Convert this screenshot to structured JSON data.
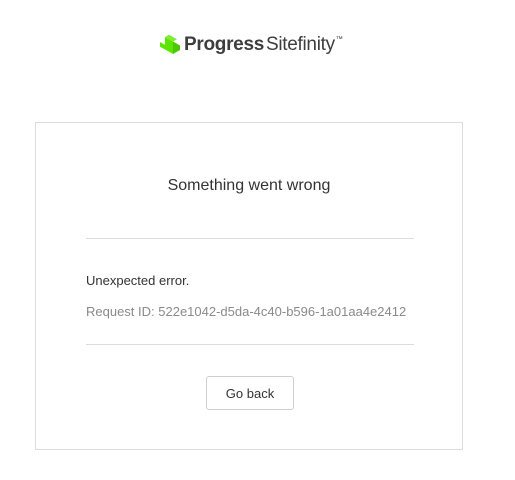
{
  "header": {
    "logo_brand": "Progress",
    "logo_product": "Sitefinity",
    "logo_trademark": "™",
    "logo_icon": "progress-logo-icon",
    "brand_color": "#5ce500"
  },
  "card": {
    "title": "Something went wrong",
    "error_message": "Unexpected error.",
    "request_id": "Request ID: 522e1042-d5da-4c40-b596-1a01aa4e2412",
    "back_button_label": "Go back"
  },
  "colors": {
    "border": "#dcdcdc",
    "text": "#333333",
    "muted_text": "#8a8a8a"
  }
}
